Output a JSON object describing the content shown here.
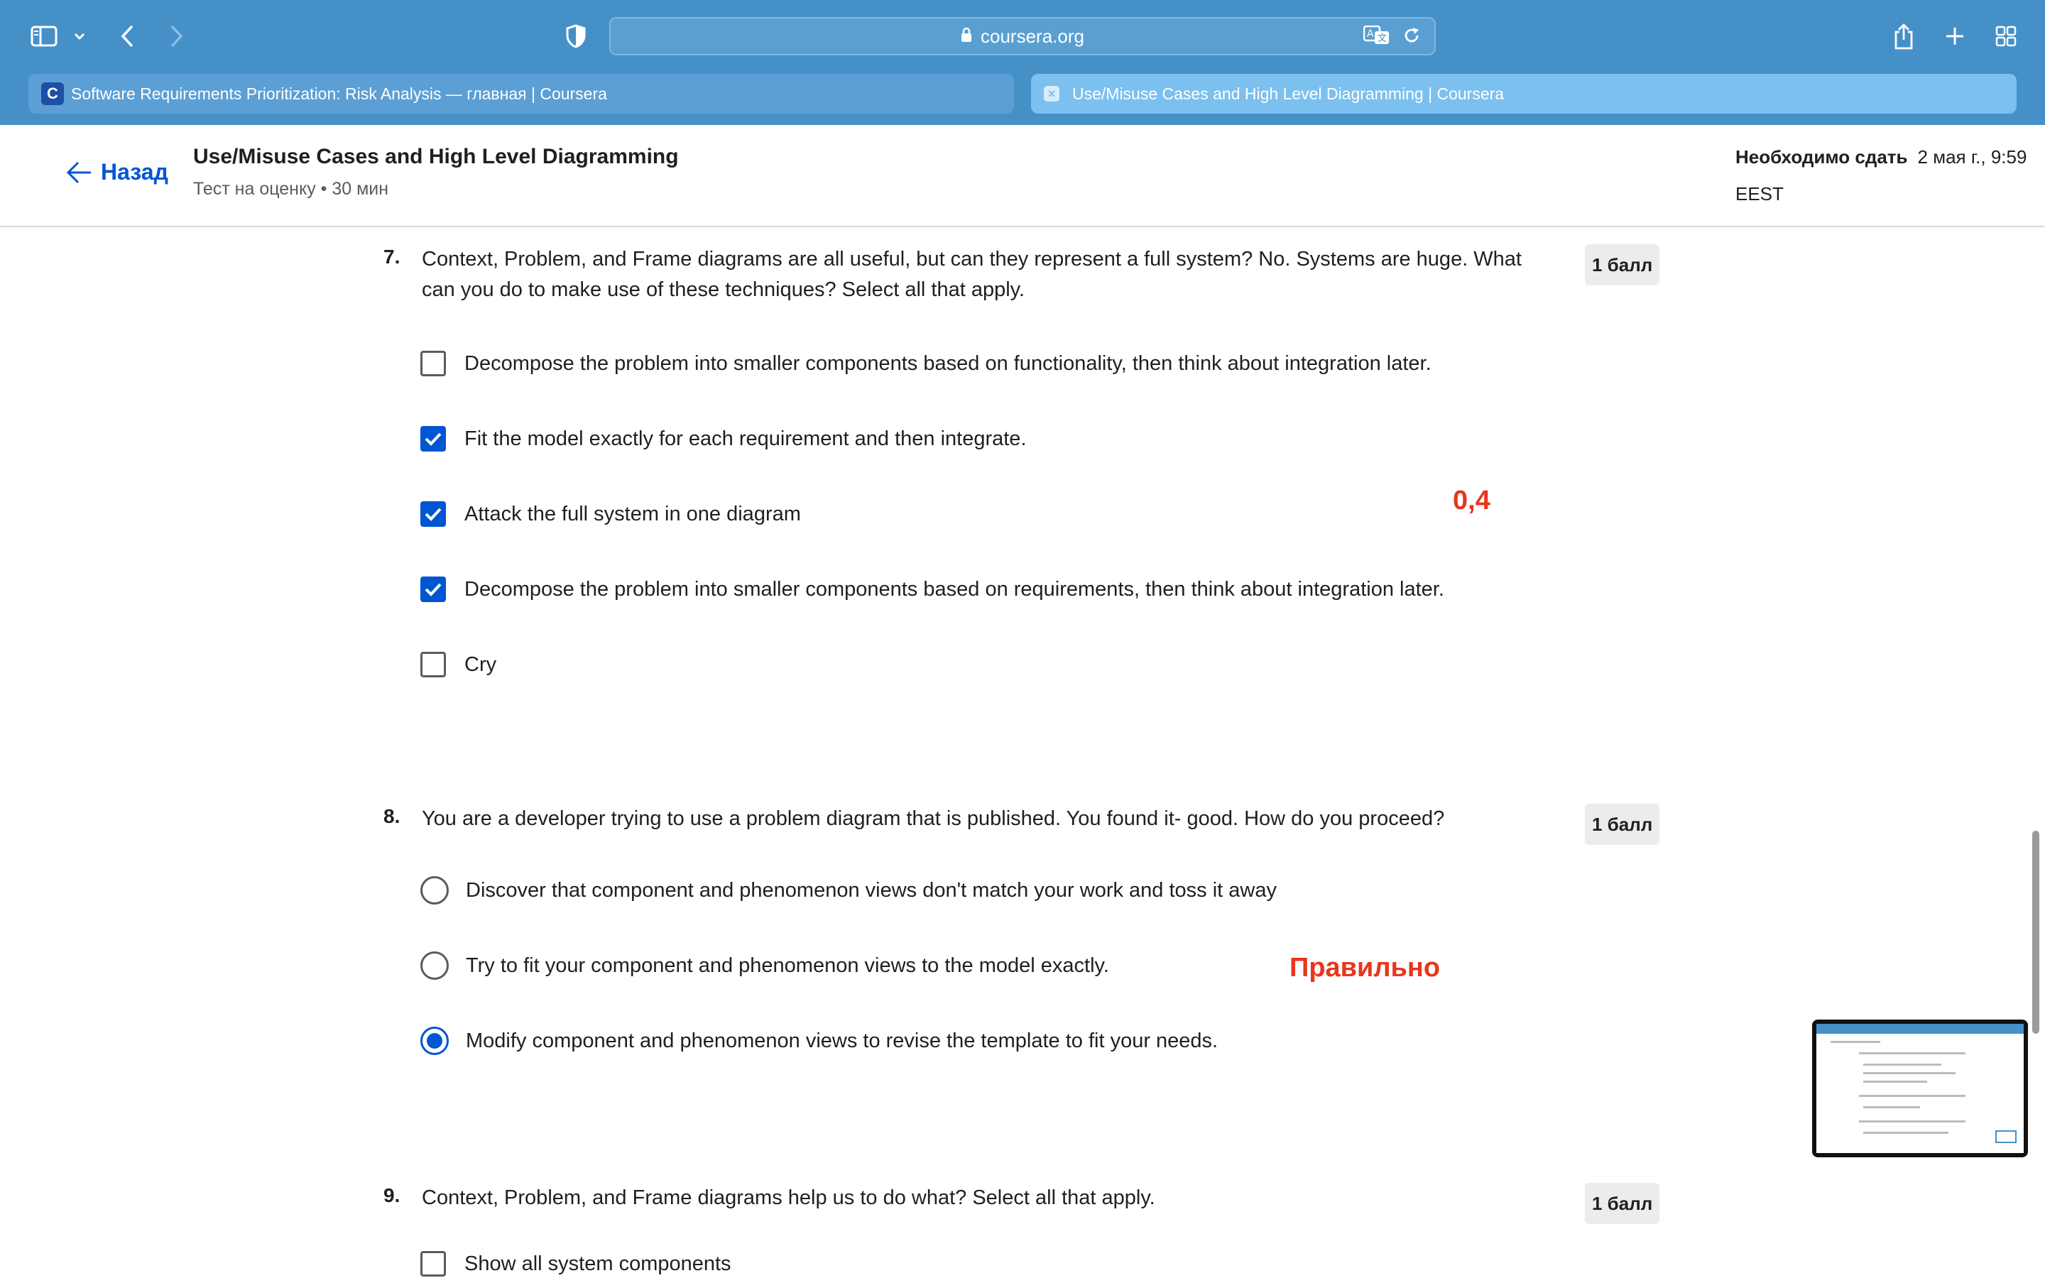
{
  "browser": {
    "address": "coursera.org",
    "tabs": [
      {
        "title": "Software Requirements Prioritization: Risk Analysis — главная | Coursera",
        "favicon": "C",
        "active": false
      },
      {
        "title": "Use/Misuse Cases and High Level Diagramming | Coursera",
        "active": true
      }
    ],
    "icons": [
      "sidebar-icon",
      "chevron-down-icon",
      "back-icon",
      "forward-icon",
      "shield-icon",
      "lock-icon",
      "translate-icon",
      "reload-icon",
      "share-icon",
      "new-tab-icon",
      "tab-overview-icon"
    ]
  },
  "header": {
    "back_label": "Назад",
    "title": "Use/Misuse Cases and High Level Diagramming",
    "subtitle": "Тест на оценку • 30 мин",
    "due_label": "Необходимо сдать",
    "due_date": "2 мая г., 9:59",
    "due_tz": "EEST"
  },
  "questions": [
    {
      "number": "7.",
      "text": "Context, Problem, and Frame diagrams are all useful, but can they represent a full system? No.  Systems are huge.  What can you do to make use of these techniques?  Select all that apply.",
      "points": "1 балл",
      "type": "checkbox",
      "options": [
        {
          "label": "Decompose the problem into smaller components based on functionality, then think about integration later.",
          "checked": false
        },
        {
          "label": "Fit the model exactly for each requirement and then integrate.",
          "checked": true
        },
        {
          "label": "Attack the full system in one diagram",
          "checked": true
        },
        {
          "label": "Decompose the problem into smaller components based on requirements, then think about integration later.",
          "checked": true
        },
        {
          "label": "Cry",
          "checked": false
        }
      ],
      "annotation": "0,4"
    },
    {
      "number": "8.",
      "text": "You are a developer trying to use a problem diagram that is published.  You found it- good.  How do you proceed?",
      "points": "1 балл",
      "type": "radio",
      "options": [
        {
          "label": "Discover that component and phenomenon views don't match your work and toss it away",
          "checked": false
        },
        {
          "label": "Try to fit your component and phenomenon views to the model exactly.",
          "checked": false
        },
        {
          "label": "Modify component and phenomenon views to revise the template to fit your needs.",
          "checked": true
        }
      ],
      "annotation": "Правильно"
    },
    {
      "number": "9.",
      "text": "Context, Problem, and Frame diagrams help us to do what? Select all that apply.",
      "points": "1 балл",
      "type": "checkbox",
      "options": [
        {
          "label": "Show all system components",
          "checked": false
        }
      ]
    }
  ],
  "colors": {
    "chrome": "#4690c8",
    "accent": "#0056d2",
    "annotation": "#e8351c"
  }
}
